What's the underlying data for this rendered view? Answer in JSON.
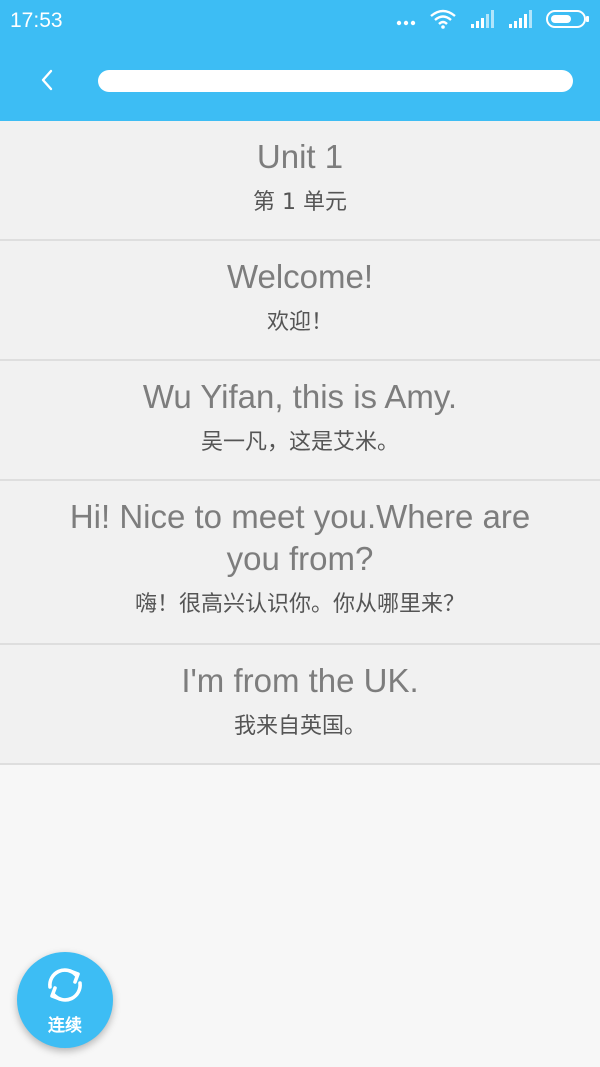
{
  "status_bar": {
    "time": "17:53",
    "icons": [
      "more-dots-icon",
      "wifi-icon",
      "signal-icon",
      "signal-icon",
      "battery-icon"
    ]
  },
  "app_bar": {
    "back_icon": "chevron-left-icon",
    "title": ""
  },
  "sentences": [
    {
      "en": "Unit 1",
      "zh": "第 1 单元"
    },
    {
      "en": "Welcome!",
      "zh": "欢迎！"
    },
    {
      "en": "Wu Yifan, this is Amy.",
      "zh": "吴一凡，这是艾米。"
    },
    {
      "en": "Hi! Nice to meet you.Where are you from?",
      "zh": "嗨！很高兴认识你。你从哪里来？"
    },
    {
      "en": "I'm from the UK.",
      "zh": "我来自英国。"
    }
  ],
  "fab": {
    "icon": "refresh-icon",
    "label": "连续"
  },
  "colors": {
    "accent": "#3dbdf4",
    "list_bg": "#f1f1f1",
    "divider": "#dedede",
    "page_bg": "#f7f7f7"
  }
}
